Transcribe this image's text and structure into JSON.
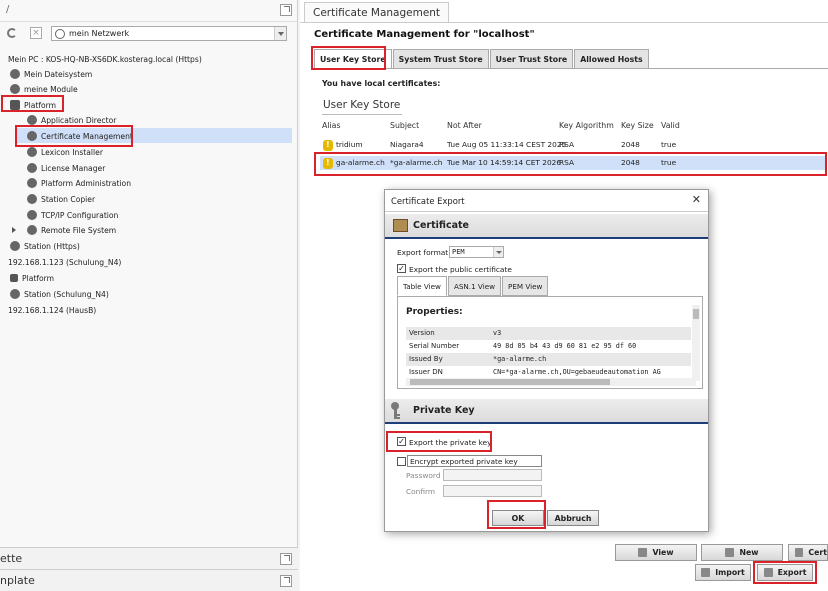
{
  "left_panel": {
    "top_slash": "/",
    "network_select": "mein Netzwerk",
    "tree": [
      {
        "label": "Mein PC : KOS-HQ-NB-XS6DK.kosterag.local (Https)"
      },
      {
        "label": "Mein Dateisystem"
      },
      {
        "label": "meine Module"
      },
      {
        "label": "Platform"
      },
      {
        "label": "Application Director"
      },
      {
        "label": "Certificate Management"
      },
      {
        "label": "Lexicon Installer"
      },
      {
        "label": "License Manager"
      },
      {
        "label": "Platform Administration"
      },
      {
        "label": "Station Copier"
      },
      {
        "label": "TCP/IP Configuration"
      },
      {
        "label": "Remote File System"
      },
      {
        "label": "Station (Https)"
      },
      {
        "label": "192.168.1.123 (Schulung_N4)"
      },
      {
        "label": "Platform"
      },
      {
        "label": "Station (Schulung_N4)"
      },
      {
        "label": "192.168.1.124 (HausB)"
      }
    ],
    "palette_label": "ette",
    "template_label": "nplate"
  },
  "right_panel": {
    "tab_title": "Certificate Management",
    "heading": "Certificate Management for \"localhost\"",
    "store_tabs": [
      "User Key Store",
      "System Trust Store",
      "User Trust Store",
      "Allowed Hosts"
    ],
    "local_certs_text": "You have local certificates:",
    "section_label": "User Key Store",
    "columns": [
      "Alias",
      "Subject",
      "Not After",
      "Key Algorithm",
      "Key Size",
      "Valid"
    ],
    "rows": [
      {
        "alias": "tridium",
        "subject": "Niagara4",
        "not_after": "Tue Aug 05 11:33:14 CEST 2025",
        "algorithm": "RSA",
        "size": "2048",
        "valid": "true"
      },
      {
        "alias": "ga-alarme.ch",
        "subject": "*ga-alarme.ch",
        "not_after": "Tue Mar 10 14:59:14 CET 2026",
        "algorithm": "RSA",
        "size": "2048",
        "valid": "true"
      }
    ],
    "buttons": {
      "view": "View",
      "new": "New",
      "cert": "Cert",
      "import": "Import",
      "export": "Export"
    }
  },
  "dialog": {
    "title": "Certificate Export",
    "close": "✕",
    "certificate_heading": "Certificate",
    "export_format_label": "Export format:",
    "export_format_value": "PEM",
    "export_public_label": "Export the public certificate",
    "view_tabs": [
      "Table View",
      "ASN.1 View",
      "PEM View"
    ],
    "properties_title": "Properties:",
    "properties": [
      {
        "key": "Version",
        "value": "v3"
      },
      {
        "key": "Serial Number",
        "value": "49 8d 05 b4 43 d9 60 81 e2 95 df 60"
      },
      {
        "key": "Issued By",
        "value": "*ga-alarme.ch"
      },
      {
        "key": "Issuer DN",
        "value": "CN=*ga-alarme.ch,OU=gebaeudeautomation AG"
      }
    ],
    "private_key_heading": "Private Key",
    "export_private_label": "Export the private key",
    "encrypt_label": "Encrypt exported private key",
    "password_label": "Password",
    "confirm_label": "Confirm",
    "ok_label": "OK",
    "cancel_label": "Abbruch"
  },
  "colors": {
    "highlight_red": "#d9222a",
    "selection_blue": "#cfe0f8",
    "section_underline": "#1d3e78"
  }
}
